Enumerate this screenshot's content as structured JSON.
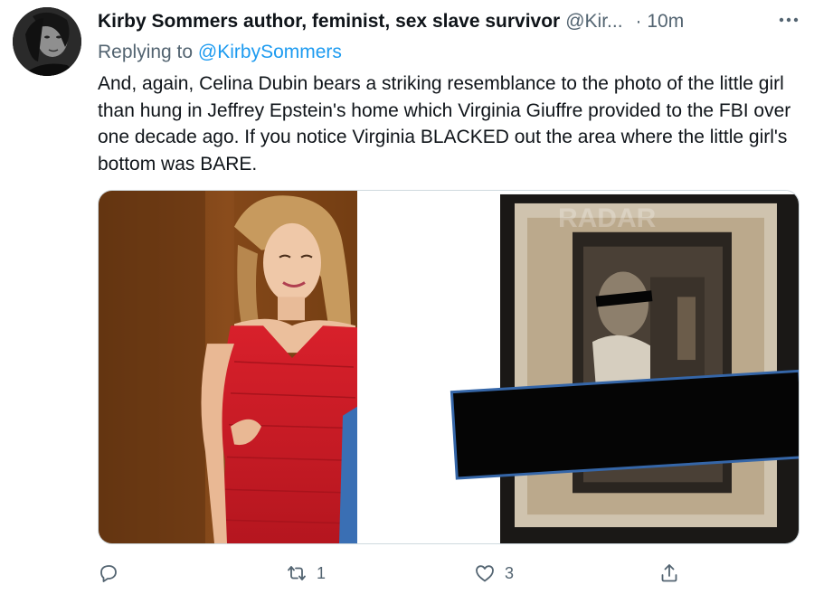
{
  "author": {
    "name": "Kirby Sommers author, feminist, sex slave survivor",
    "handle": "@Kir...",
    "time": "· 10m"
  },
  "reply": {
    "prefix": "Replying to ",
    "handle": "@KirbySommers"
  },
  "tweet": {
    "text": "And, again, Celina Dubin bears a striking resemblance to the photo of the little girl than hung in Jeffrey Epstein's home which Virginia Giuffre provided to the FBI over one decade ago. If you notice Virginia BLACKED out the area where the little girl's bottom was BARE."
  },
  "media": {
    "watermark": "RADAR",
    "left_alt": "Woman in red dress",
    "right_alt": "Framed photo with black redaction bar"
  },
  "actions": {
    "reply_count": "",
    "retweet_count": "1",
    "like_count": "3"
  },
  "icons": {
    "more": "more-horizontal-icon",
    "reply": "reply-icon",
    "retweet": "retweet-icon",
    "like": "heart-icon",
    "share": "share-icon"
  },
  "colors": {
    "text": "#0f1419",
    "secondary": "#536471",
    "link": "#1d9bf0",
    "border": "#cfd9de"
  }
}
